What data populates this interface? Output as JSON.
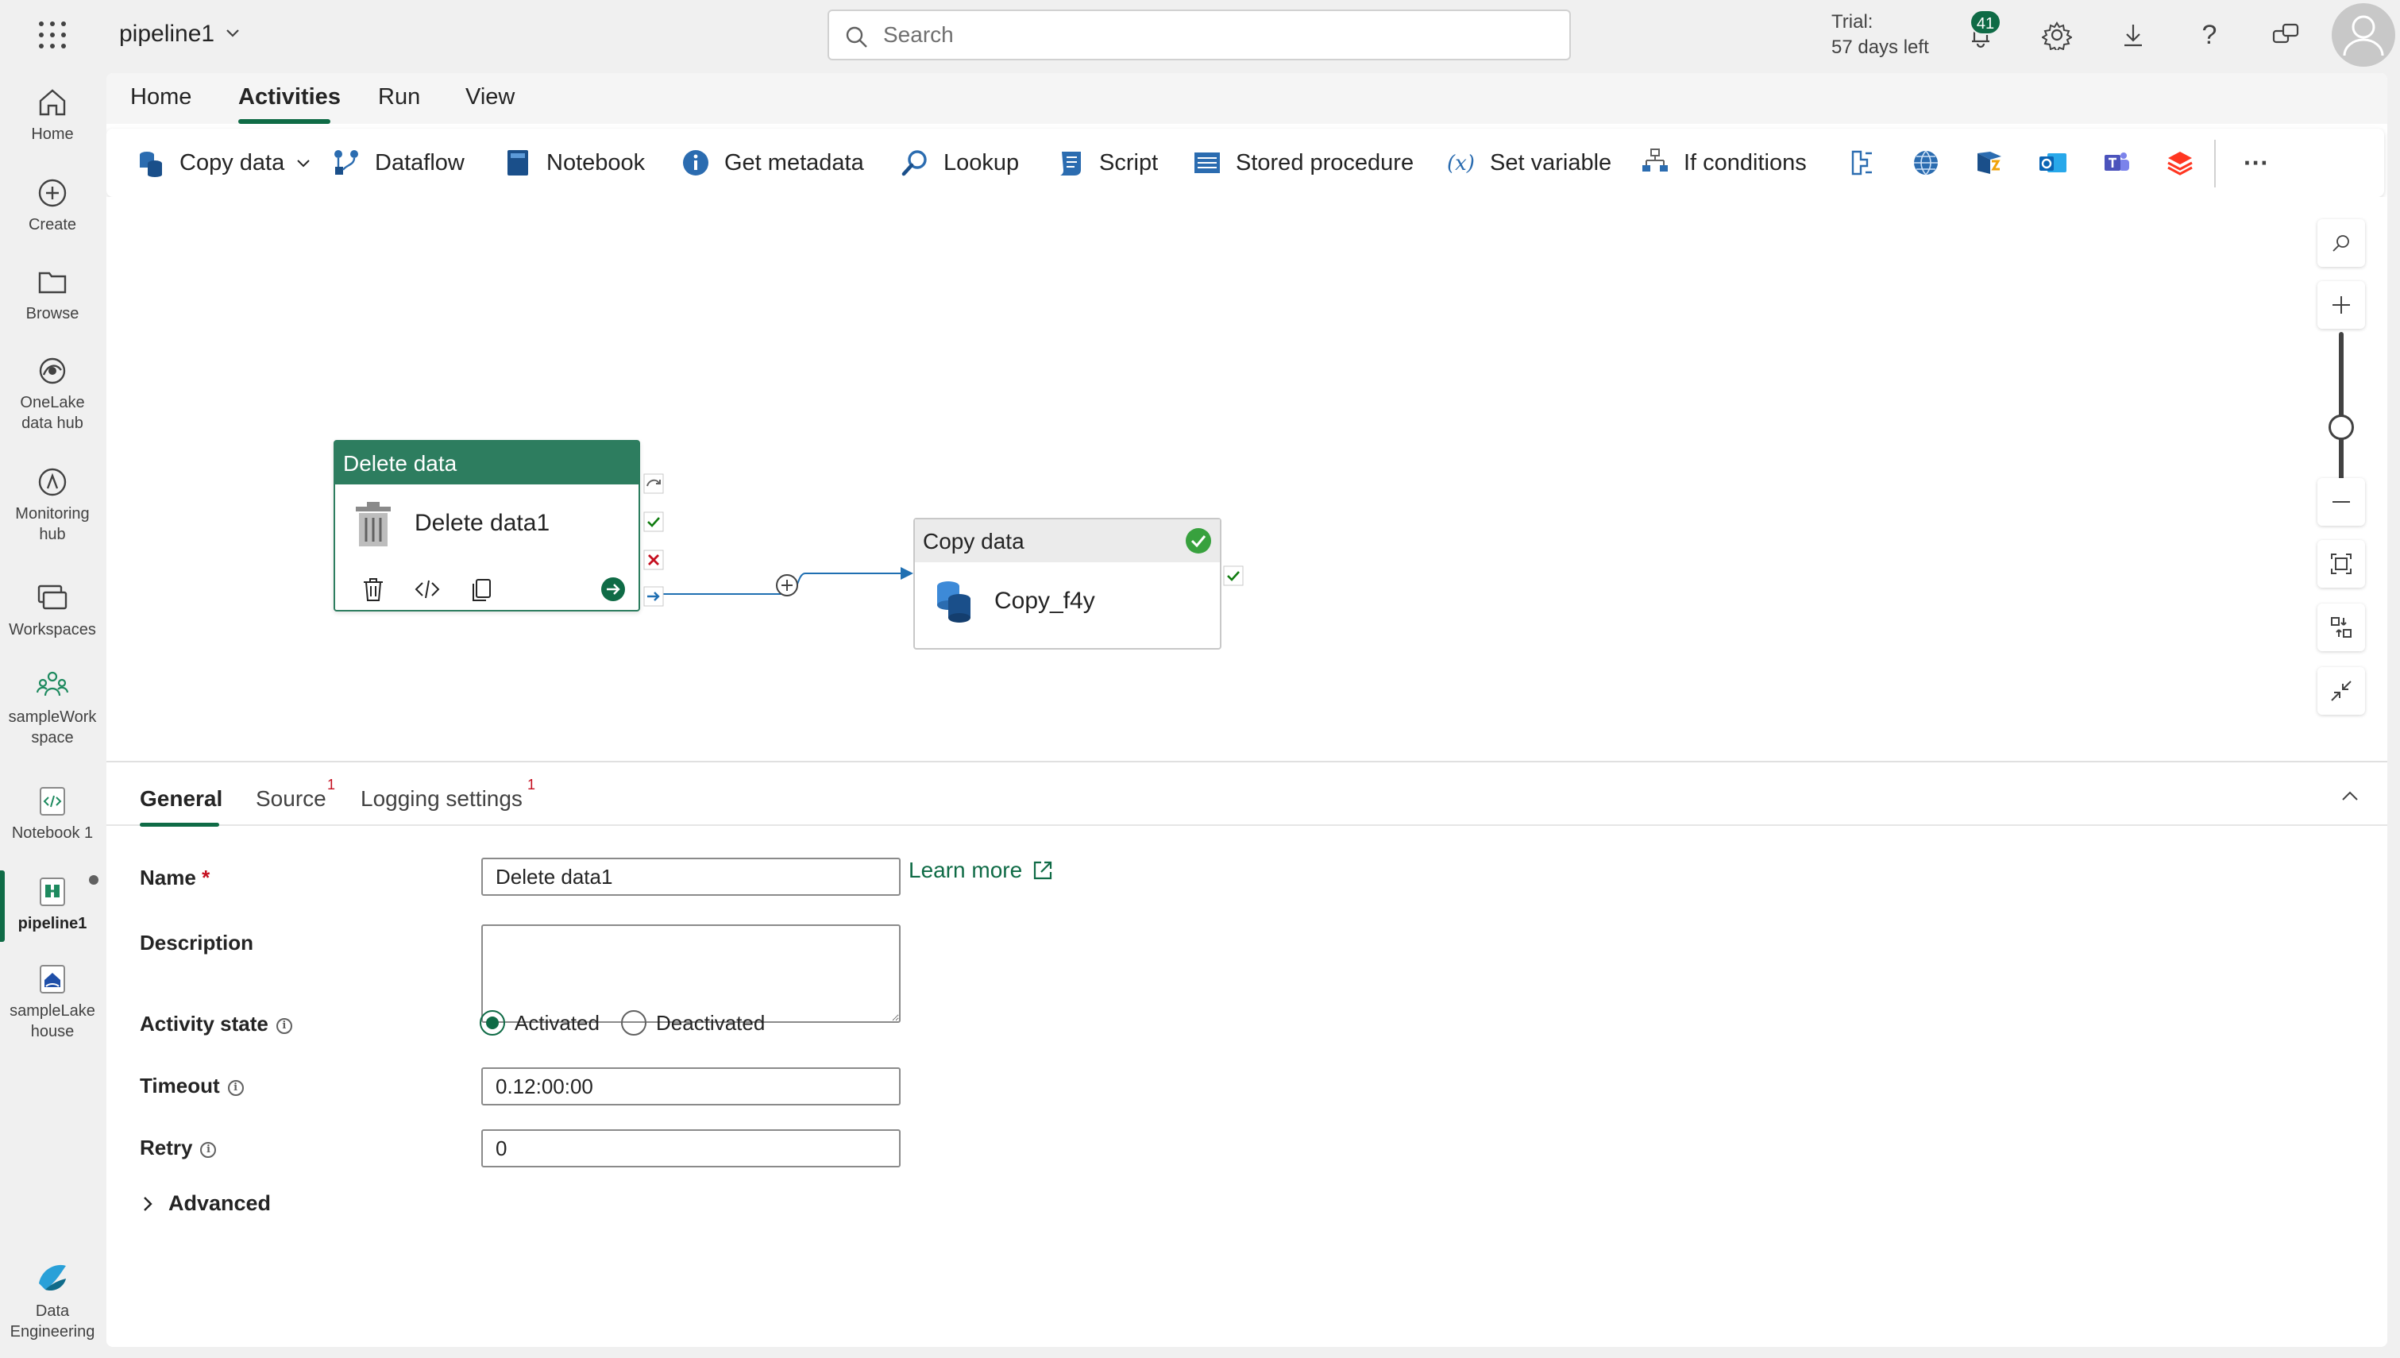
{
  "header": {
    "app_title": "pipeline1",
    "search_placeholder": "Search",
    "trial_label": "Trial:",
    "trial_days": "57 days left",
    "notification_count": "41",
    "help_glyph": "?"
  },
  "left_rail": {
    "items": [
      {
        "label": "Home",
        "icon": "home-icon"
      },
      {
        "label": "Create",
        "icon": "create-icon"
      },
      {
        "label": "Browse",
        "icon": "folder-icon"
      },
      {
        "label": "OneLake data hub",
        "icon": "onelake-icon"
      },
      {
        "label": "Monitoring hub",
        "icon": "monitoring-icon"
      },
      {
        "label": "Workspaces",
        "icon": "workspaces-icon"
      },
      {
        "label": "sampleWork space",
        "icon": "workspace-people-icon"
      },
      {
        "label": "Notebook 1",
        "icon": "notebook-icon"
      },
      {
        "label": "pipeline1",
        "icon": "pipeline-icon",
        "active": true
      },
      {
        "label": "sampleLake house",
        "icon": "lakehouse-icon"
      },
      {
        "label": "Data Engineering",
        "icon": "data-engineering-icon"
      }
    ]
  },
  "menu": {
    "tabs": [
      "Home",
      "Activities",
      "Run",
      "View"
    ],
    "active_tab": "Activities"
  },
  "ribbon": {
    "buttons": [
      {
        "label": "Copy data",
        "icon": "copy-data-icon",
        "has_dropdown": true
      },
      {
        "label": "Dataflow",
        "icon": "dataflow-icon"
      },
      {
        "label": "Notebook",
        "icon": "notebook-icon"
      },
      {
        "label": "Get metadata",
        "icon": "info-icon"
      },
      {
        "label": "Lookup",
        "icon": "lookup-icon"
      },
      {
        "label": "Script",
        "icon": "script-icon"
      },
      {
        "label": "Stored procedure",
        "icon": "stored-procedure-icon"
      },
      {
        "label": "Set variable",
        "icon": "variable-icon"
      },
      {
        "label": "If conditions",
        "icon": "if-conditions-icon"
      }
    ],
    "icon_only": [
      "switch-icon",
      "web-icon",
      "azure-function-icon",
      "outlook-icon",
      "teams-icon",
      "databricks-icon"
    ],
    "more": "···"
  },
  "canvas": {
    "delete_node": {
      "header": "Delete data",
      "name": "Delete data1"
    },
    "copy_node": {
      "header": "Copy data",
      "name": "Copy_f4y",
      "status": "succeeded"
    },
    "zoom_level": 0.5
  },
  "properties": {
    "tabs": [
      {
        "label": "General",
        "badge": ""
      },
      {
        "label": "Source",
        "badge": "1"
      },
      {
        "label": "Logging settings",
        "badge": "1"
      }
    ],
    "active_tab": "General",
    "fields": {
      "name_label": "Name",
      "required_mark": "*",
      "name_value": "Delete data1",
      "learn_more": "Learn more",
      "description_label": "Description",
      "description_value": "",
      "activity_state_label": "Activity state",
      "activated_label": "Activated",
      "deactivated_label": "Deactivated",
      "activity_state_value": "Activated",
      "timeout_label": "Timeout",
      "timeout_value": "0.12:00:00",
      "retry_label": "Retry",
      "retry_value": "0",
      "advanced_label": "Advanced"
    }
  },
  "colors": {
    "brand_green": "#0f6b46",
    "node_header_green": "#2d7d5f",
    "error_red": "#c50f1f",
    "connector_blue": "#1f6fb2"
  }
}
